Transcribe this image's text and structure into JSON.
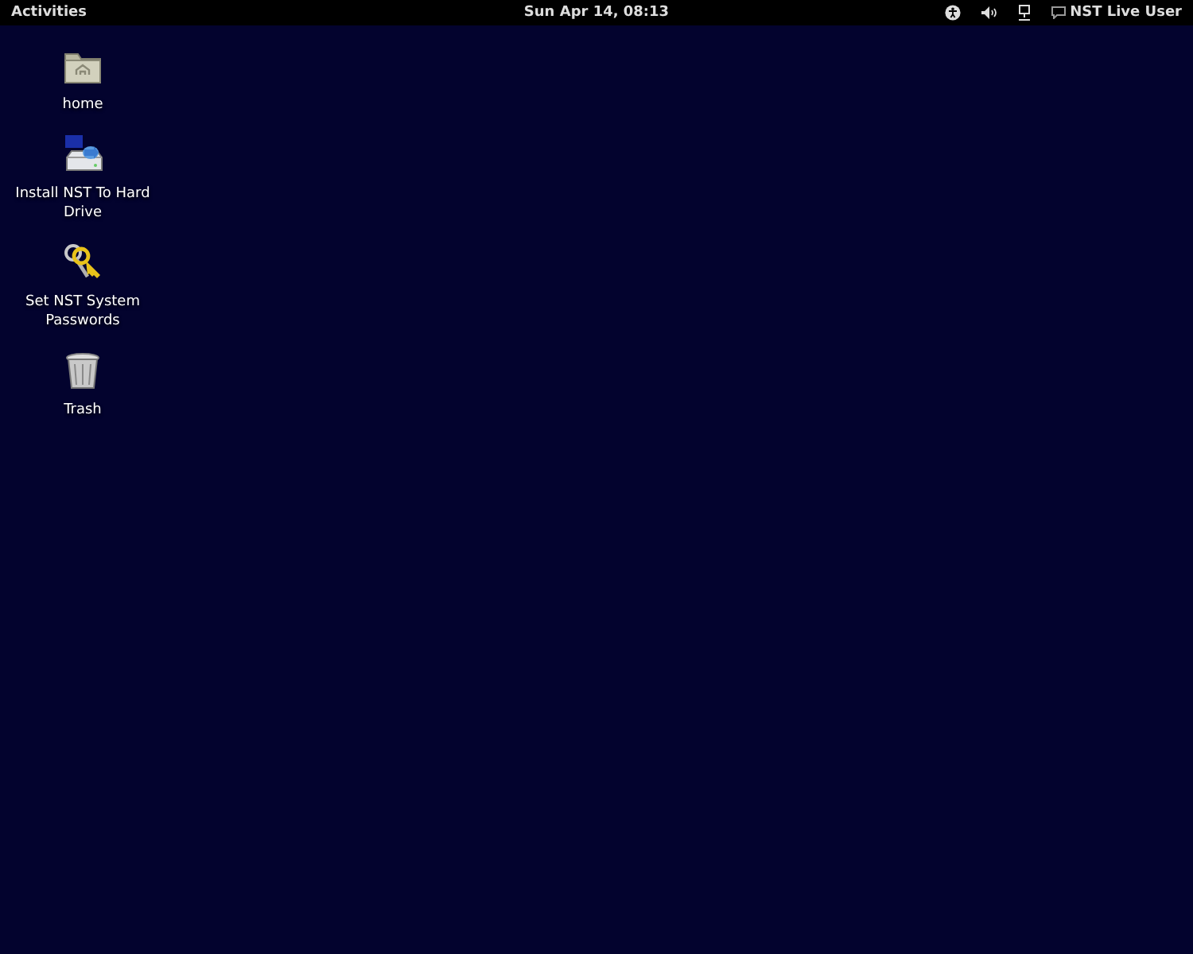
{
  "top_bar": {
    "activities": "Activities",
    "clock": "Sun Apr 14, 08:13",
    "user": "NST Live User"
  },
  "desktop_icons": [
    {
      "label": "home",
      "kind": "folder"
    },
    {
      "label": "Install NST To Hard Drive",
      "kind": "drive"
    },
    {
      "label": "Set NST System Passwords",
      "kind": "keys"
    },
    {
      "label": "Trash",
      "kind": "trash"
    }
  ]
}
